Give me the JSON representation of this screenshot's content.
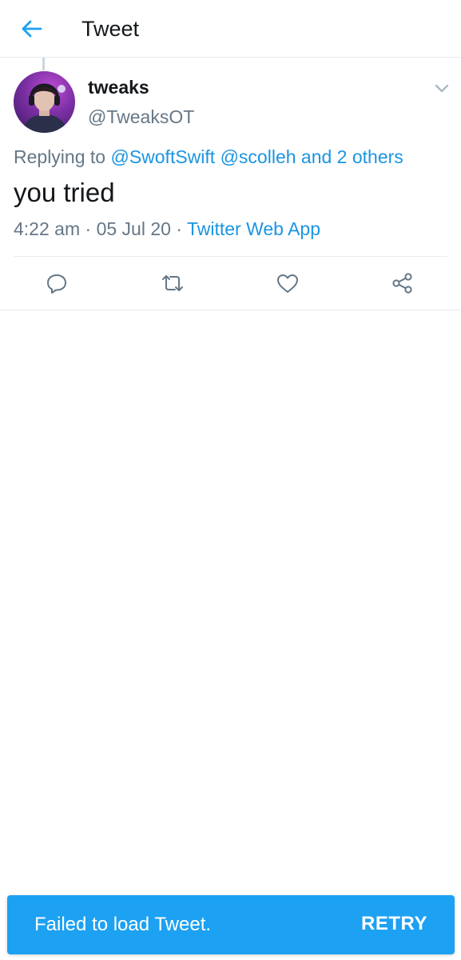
{
  "header": {
    "title": "Tweet",
    "back_icon": "arrow-left-icon"
  },
  "tweet": {
    "author_name": "tweaks",
    "author_handle": "@TweaksOT",
    "replying_to_label": "Replying to",
    "mentions": [
      "@SwoftSwift",
      "@scolleh"
    ],
    "others": "and 2 others",
    "text": "you tried",
    "time": "4:22 am",
    "separator": "·",
    "date": "05 Jul 20",
    "source": "Twitter Web App"
  },
  "actions": [
    {
      "icon": "reply-icon"
    },
    {
      "icon": "retweet-icon"
    },
    {
      "icon": "like-icon"
    },
    {
      "icon": "share-icon"
    }
  ],
  "toast": {
    "message": "Failed to load Tweet.",
    "action": "RETRY"
  },
  "colors": {
    "accent": "#1da1f2",
    "link": "#1b95e0",
    "secondary_text": "#657786",
    "divider": "#e6ecf0"
  }
}
